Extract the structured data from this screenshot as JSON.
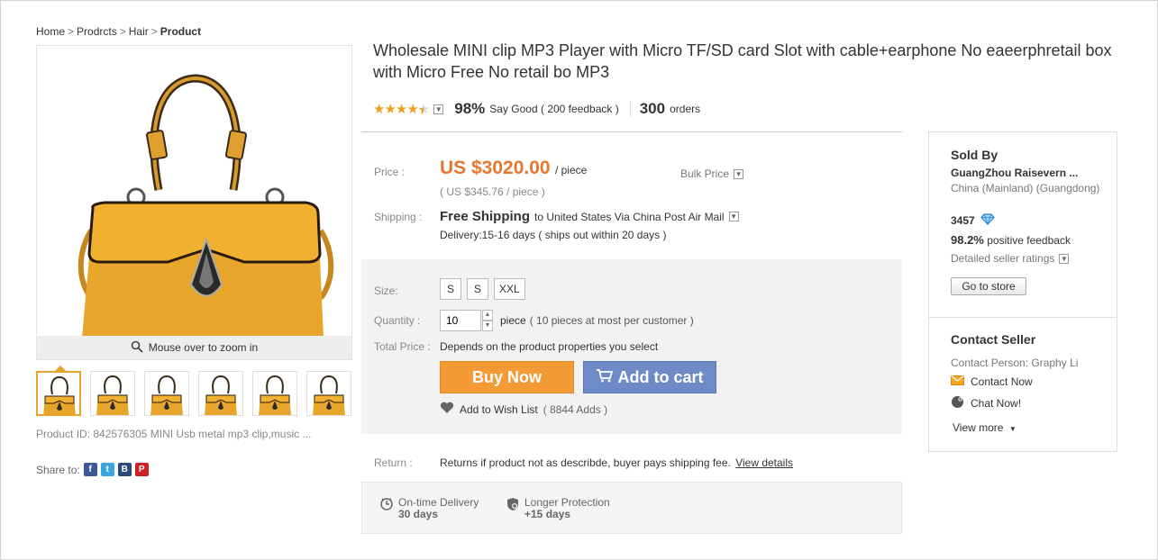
{
  "breadcrumb": {
    "items": [
      "Home",
      "Prodrcts",
      "Hair"
    ],
    "current": "Product",
    "separator": ">"
  },
  "gallery": {
    "zoom_hint": "Mouse over to zoom in",
    "thumb_count": 6
  },
  "product_id": "Product ID: 842576305 MINI Usb metal mp3 clip,music ...",
  "share": {
    "label": "Share to:"
  },
  "title": "Wholesale MINI clip MP3 Player with Micro TF/SD card Slot with cable+earphone No eaeerphretail box with Micro Free  No retail bo MP3",
  "rating": {
    "stars": 4.5,
    "percent": "98%",
    "say_good": "Say Good",
    "feedback": "( 200 feedback )",
    "orders_num": "300",
    "orders_label": "orders"
  },
  "price": {
    "label": "Price :",
    "amount": "US $3020.00",
    "unit": "/ piece",
    "sub": "( US $345.76 / piece )",
    "bulk": "Bulk Price"
  },
  "shipping": {
    "label": "Shipping :",
    "free": "Free Shipping",
    "to": "to United States Via China Post Air Mail",
    "delivery": "Delivery:15-16 days ( ships out within 20 days )"
  },
  "options": {
    "size_label": "Size:",
    "sizes": [
      "S",
      "S",
      "XXL"
    ],
    "quantity_label": "Quantity :",
    "quantity_value": "10",
    "quantity_unit": "piece",
    "quantity_hint": "( 10 pieces at most per customer )",
    "total_label": "Total Price :",
    "total_value": "Depends on the product properties you select"
  },
  "actions": {
    "buy_now": "Buy Now",
    "add_to_cart": "Add to cart",
    "wish_list": "Add to Wish List",
    "wish_count": "( 8844 Adds )"
  },
  "return": {
    "label": "Return :",
    "text": "Returns if product not as describde, buyer pays shipping fee.",
    "link": "View details"
  },
  "guarantees": [
    {
      "title": "On-time Delivery",
      "value": "30 days"
    },
    {
      "title": "Longer Protection",
      "value": "+15 days"
    }
  ],
  "seller": {
    "sold_by": "Sold By",
    "name": "GuangZhou Raisevern ...",
    "location": "China (Mainland) (Guangdong)",
    "score": "3457",
    "positive_pct": "98.2%",
    "positive_label": "positive feedback",
    "detailed": "Detailed seller ratings",
    "go_store": "Go to store",
    "contact_title": "Contact Seller",
    "contact_person": "Contact Person: Graphy Li",
    "contact_now": "Contact Now",
    "chat_now": "Chat Now!",
    "view_more": "View more"
  },
  "colors": {
    "price": "#e8772e",
    "buy": "#f49a35",
    "cart": "#6f8bc7",
    "bag": "#e8a52c",
    "star": "#f0a020"
  }
}
